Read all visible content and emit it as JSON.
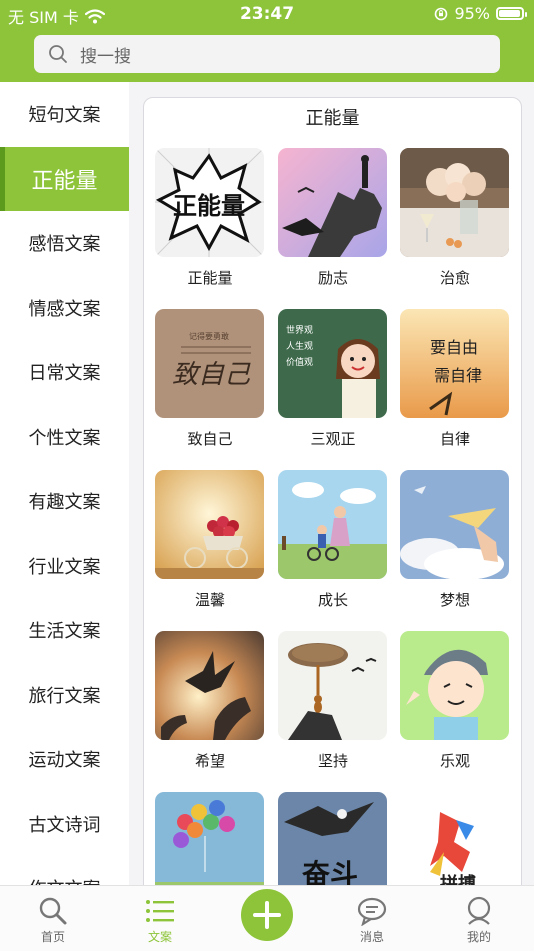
{
  "status_bar": {
    "carrier": "无 SIM 卡",
    "time": "23:47",
    "battery": "95%",
    "battery_level": 0.95
  },
  "search": {
    "placeholder": "搜一搜"
  },
  "sidebar": {
    "items": [
      {
        "label": "短句文案",
        "active": false
      },
      {
        "label": "正能量",
        "active": true
      },
      {
        "label": "感悟文案",
        "active": false
      },
      {
        "label": "情感文案",
        "active": false
      },
      {
        "label": "日常文案",
        "active": false
      },
      {
        "label": "个性文案",
        "active": false
      },
      {
        "label": "有趣文案",
        "active": false
      },
      {
        "label": "行业文案",
        "active": false
      },
      {
        "label": "生活文案",
        "active": false
      },
      {
        "label": "旅行文案",
        "active": false
      },
      {
        "label": "运动文案",
        "active": false
      },
      {
        "label": "古文诗词",
        "active": false
      },
      {
        "label": "作文文案",
        "active": false
      }
    ]
  },
  "category": {
    "title": "正能量",
    "tiles": [
      {
        "label": "正能量"
      },
      {
        "label": "励志"
      },
      {
        "label": "治愈"
      },
      {
        "label": "致自己",
        "img_text": "致自己",
        "img_small_text": "记得要勇敢"
      },
      {
        "label": "三观正",
        "img_text": "世界观 人生观 价值观"
      },
      {
        "label": "自律",
        "img_text": "要自由 需自律"
      },
      {
        "label": "温馨"
      },
      {
        "label": "成长"
      },
      {
        "label": "梦想"
      },
      {
        "label": "希望"
      },
      {
        "label": "坚持"
      },
      {
        "label": "乐观"
      },
      {
        "label": ""
      },
      {
        "label": "",
        "img_text": "奋斗"
      },
      {
        "label": "",
        "img_text": "拼搏"
      }
    ],
    "energy_img_text": "正能量"
  },
  "tabbar": {
    "tabs": [
      {
        "label": "首页",
        "icon": "search-icon"
      },
      {
        "label": "文案",
        "icon": "list-icon",
        "active": true
      },
      {
        "label": "",
        "icon": "plus-icon"
      },
      {
        "label": "消息",
        "icon": "message-icon"
      },
      {
        "label": "我的",
        "icon": "profile-icon"
      }
    ]
  },
  "colors": {
    "accent": "#8dc43a",
    "accent_dark": "#5c9a1e"
  }
}
